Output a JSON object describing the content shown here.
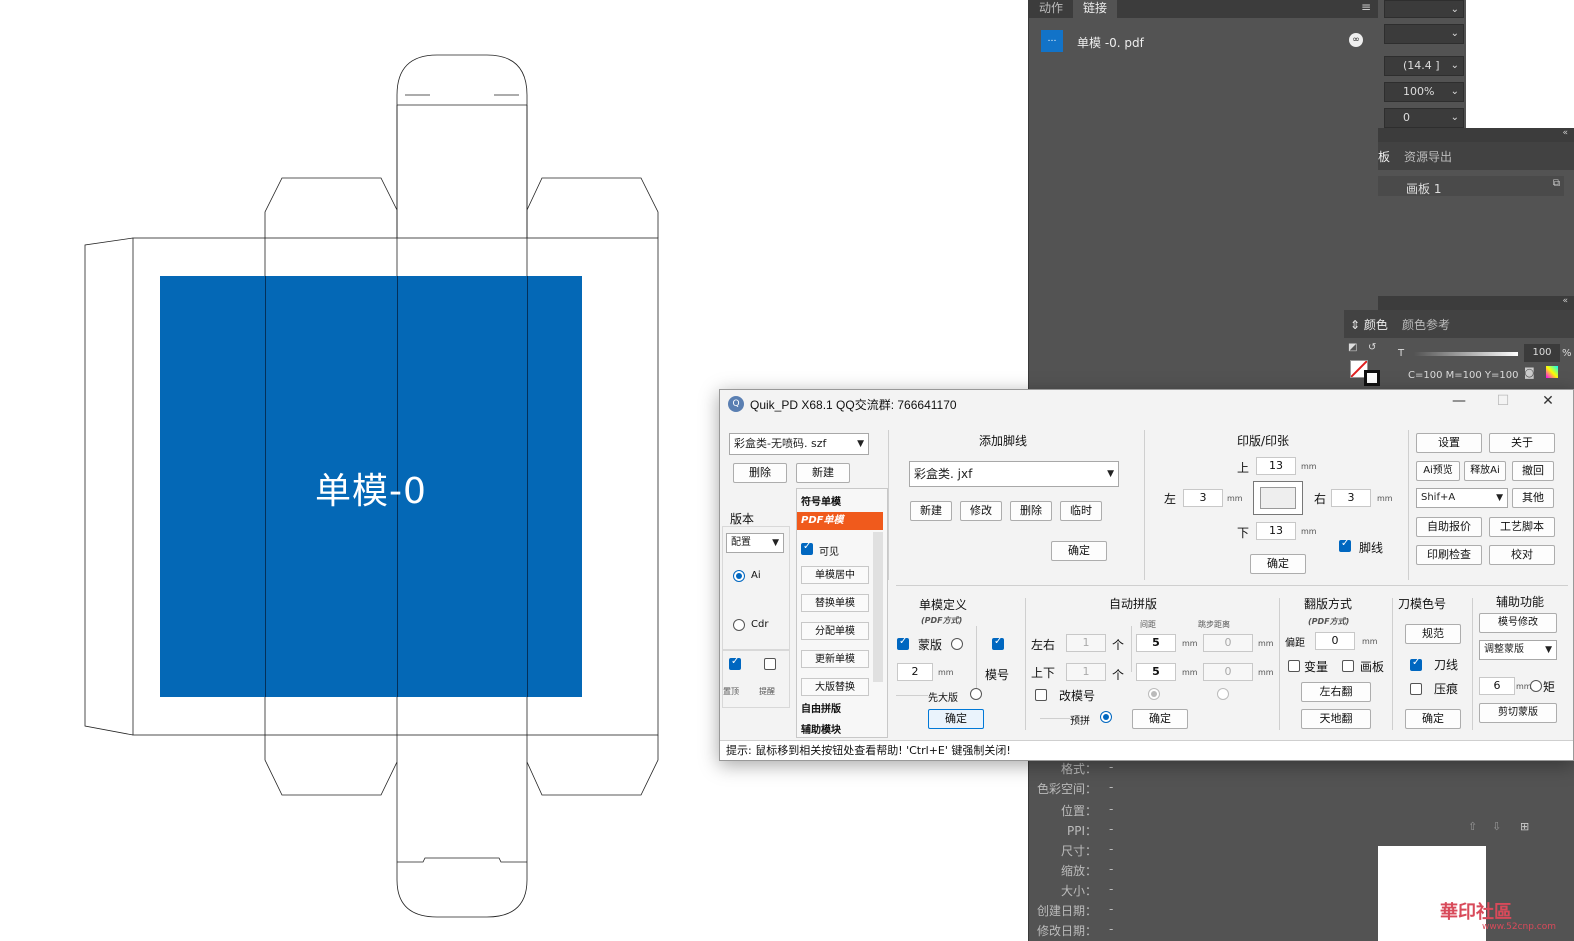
{
  "canvas": {
    "design_label": "单模-0",
    "fill_color": "#0468b6"
  },
  "links_panel": {
    "tabs": [
      "动作",
      "链接"
    ],
    "menu_icon": "hamburger-icon",
    "link_item": {
      "thumb_label": "…",
      "name": "单模 -0. pdf"
    },
    "info_rows": [
      {
        "label": "格式：",
        "value": "-"
      },
      {
        "label": "色彩空间：",
        "value": "-"
      },
      {
        "label": "位置：",
        "value": "-"
      },
      {
        "label": "PPI：",
        "value": "-"
      },
      {
        "label": "尺寸：",
        "value": "-"
      },
      {
        "label": "缩放：",
        "value": "-"
      },
      {
        "label": "大小：",
        "value": "-"
      },
      {
        "label": "创建日期：",
        "value": "-"
      },
      {
        "label": "修改日期：",
        "value": "-"
      }
    ]
  },
  "right_panels": {
    "controls": [
      "(14.4 ]",
      "100%",
      "0"
    ],
    "artboard_tabs": [
      "板",
      "资源导出"
    ],
    "artboard_item": "画板 1",
    "color_tabs": [
      "颜色",
      "颜色参考"
    ],
    "color_slider_label": "T",
    "color_slider_value": "100",
    "color_slider_unit": "%",
    "cmy_text": "C=100 M=100 Y=100"
  },
  "dialog": {
    "title": "Quik_PD X68.1  QQ交流群: 766641170",
    "left": {
      "file_combo": "彩盒类-无喷码. szf",
      "delete_btn": "删除",
      "new_btn": "新建",
      "version_label": "版本",
      "config_combo": "配置",
      "radio_ai": "Ai",
      "radio_cdr": "Cdr",
      "top_label": "置顶",
      "hint_label": "提醒",
      "list_items": [
        "符号单模",
        "PDF单模",
        "可见",
        "单模居中",
        "替换单模",
        "分配单模",
        "更新单模",
        "大版替换",
        "自由拼版",
        "辅助模块"
      ]
    },
    "foot": {
      "title": "添加脚线",
      "combo": "彩盒类. jxf",
      "buttons": [
        "新建",
        "修改",
        "删除",
        "临时"
      ],
      "confirm": "确定"
    },
    "print": {
      "title": "印版/印张",
      "top_label": "上",
      "top_val": "13",
      "left_label": "左",
      "left_val": "3",
      "right_label": "右",
      "right_val": "3",
      "bottom_label": "下",
      "bottom_val": "13",
      "unit": "mm",
      "footline_label": "脚线",
      "confirm": "确定"
    },
    "side_buttons": [
      "设置",
      "关于",
      "Ai预览",
      "释放Ai",
      "撤回",
      "Shif+A",
      "其他",
      "自助报价",
      "工艺脚本",
      "印刷检查",
      "校对"
    ],
    "single": {
      "title": "单模定义",
      "sub": "(PDF方式)",
      "mask": "蒙版",
      "mold_no": "模号",
      "val": "2",
      "unit": "mm",
      "first_big": "先大版",
      "confirm": "确定"
    },
    "auto": {
      "title": "自动拼版",
      "spacing": "间距",
      "jump": "跳步距离",
      "lr": "左右",
      "ud": "上下",
      "lr_count": "1",
      "ud_count": "1",
      "count_unit": "个",
      "lr_gap": "5",
      "ud_gap": "5",
      "lr_jump": "0",
      "ud_jump": "0",
      "unit": "mm",
      "change_no": "改模号",
      "pre": "预拼",
      "confirm": "确定"
    },
    "flip": {
      "title": "翻版方式",
      "sub": "(PDF方式)",
      "offset": "偏距",
      "offset_val": "0",
      "unit": "mm",
      "vary": "变量",
      "board": "画板",
      "lr_flip": "左右翻",
      "ud_flip": "天地翻"
    },
    "knife": {
      "title": "刀模色号",
      "norm": "规范",
      "knife_line": "刀线",
      "crease": "压痕",
      "confirm": "确定"
    },
    "aux": {
      "title": "辅助功能",
      "mold_edit": "模号修改",
      "adjust_combo": "调整蒙版",
      "val": "6",
      "unit": "mm",
      "rect": "矩",
      "cut_mask": "剪切蒙版"
    },
    "status": "提示: 鼠标移到相关按钮处查看帮助!  'Ctrl+E' 键强制关闭!"
  },
  "watermark": {
    "text": "華印社區",
    "sub": "www.52cnp.com"
  }
}
